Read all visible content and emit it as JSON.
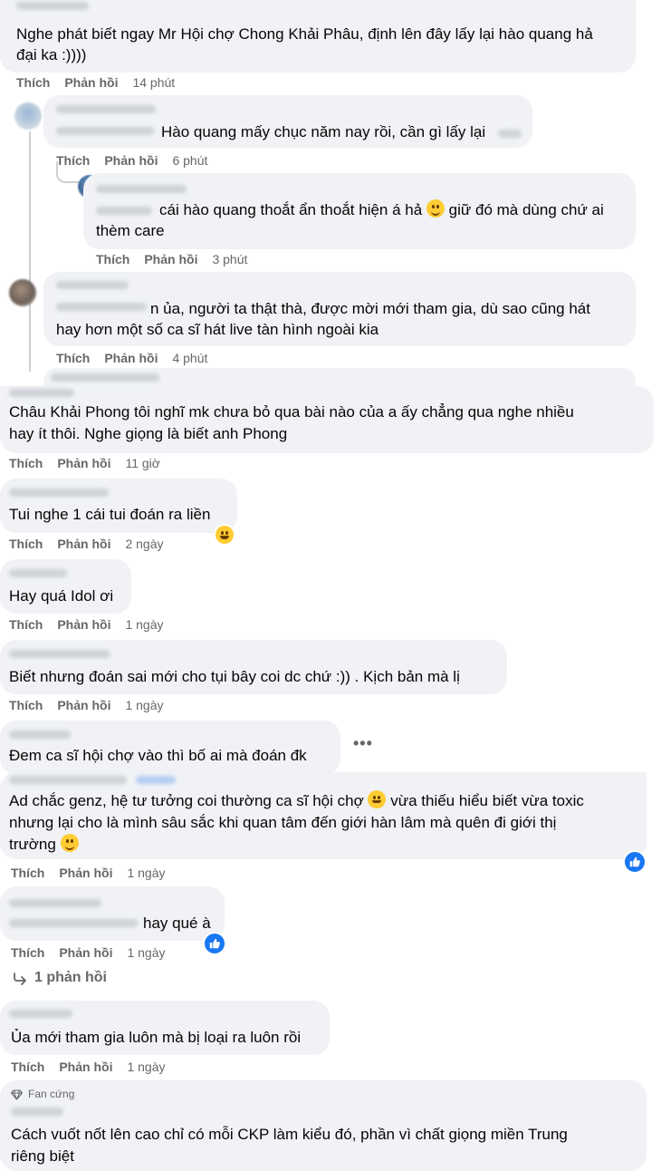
{
  "actions": {
    "like": "Thích",
    "reply": "Phản hồi"
  },
  "comments": [
    {
      "lines": [
        "Nghe phát biết ngay Mr Hội chợ Chong Khải Phâu, định lên đây lấy lại hào quang hả",
        "đại ka :))))"
      ],
      "time": "14 phút"
    },
    {
      "lines": [
        "Hào quang mấy chục năm nay rồi, cần gì lấy lại"
      ],
      "time": "6 phút"
    },
    {
      "lines": [
        "cái hào quang thoắt ẩn thoắt hiện á hả",
        "giữ đó mà dùng chứ ai",
        "thèm care"
      ],
      "time": "3 phút"
    },
    {
      "lines": [
        "n ủa, người ta thật thà, được mời mới tham gia, dù sao cũng hát",
        "hay hơn một số ca sĩ hát live tàn hình ngoài kia"
      ],
      "time": "4 phút"
    },
    {
      "lines": [
        "Châu Khải Phong tôi nghĩ mk chưa bỏ qua bài nào của a ấy chẳng qua nghe nhiều",
        "hay ít thôi. Nghe giọng là biết anh Phong"
      ],
      "time": "11 giờ"
    },
    {
      "lines": [
        "Tui nghe 1 cái tui đoán ra liền"
      ],
      "time": "2 ngày"
    },
    {
      "lines": [
        "Hay quá Idol ơi"
      ],
      "time": "1 ngày"
    },
    {
      "lines": [
        "Biết nhưng đoán sai mới cho tụi bây coi dc chứ :)) . Kịch bản mà lị"
      ],
      "time": "1 ngày"
    },
    {
      "lines": [
        "Đem ca sĩ hội chợ vào thì bố ai mà đoán đk"
      ]
    },
    {
      "lines": [
        "Ad chắc genz, hệ tư tưởng coi thường ca sĩ hội chợ",
        "vừa thiếu hiểu biết vừa toxic",
        "nhưng lại cho là mình sâu sắc khi quan tâm đến giới hàn lâm mà quên đi giới thị",
        "trường"
      ],
      "time": "1 ngày"
    },
    {
      "lines": [
        "hay qué à"
      ],
      "time": "1 ngày"
    },
    {
      "lines": [
        "Ủa mới tham gia luôn mà bị loại ra luôn rồi"
      ],
      "time": "1 ngày"
    },
    {
      "badge": "Fan cứng",
      "lines": [
        "Cách vuốt nốt lên cao chỉ có mỗi CKP làm kiểu đó, phần vì chất giọng miền Trung",
        "riêng biệt"
      ]
    }
  ],
  "replies_link": "1 phản hồi",
  "icons": {
    "like_badge": "thumbs-up-icon",
    "more": "more-options-icon",
    "reply_arrow": "reply-arrow-icon",
    "fan_badge": "diamond-icon"
  },
  "colors": {
    "bubble": "#f0f2f5",
    "meta": "#65676b",
    "like_blue": "#1877f2"
  }
}
